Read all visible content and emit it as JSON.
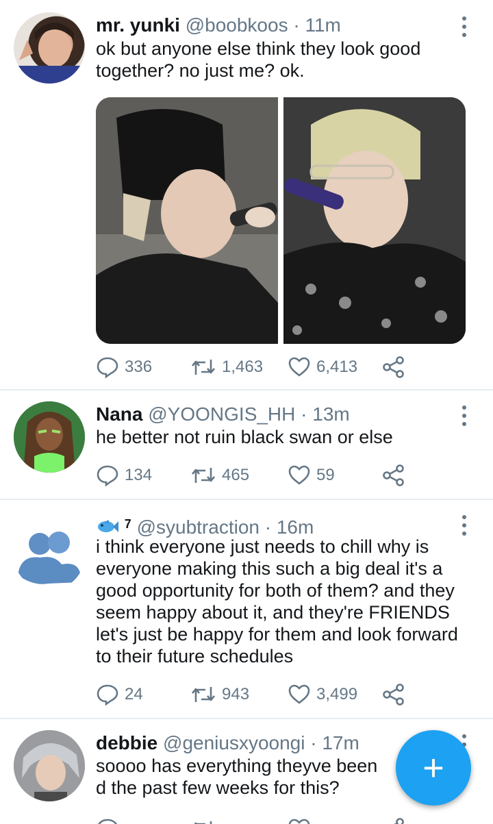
{
  "tweets": [
    {
      "name": "mr. yunki",
      "handle": "@boobkoos",
      "time": "· 11m",
      "text": "ok but anyone else think they look good together? no just me? ok.",
      "replies": "336",
      "retweets": "1,463",
      "likes": "6,413"
    },
    {
      "name": "Nana",
      "handle": "@YOONGIS_HH",
      "time": "· 13m",
      "text": "he better not ruin black swan or else",
      "replies": "134",
      "retweets": "465",
      "likes": "59"
    },
    {
      "name_superscript": "7",
      "handle": "@syubtraction",
      "time": "· 16m",
      "text": "i think everyone just needs to chill why is everyone making this such a big deal it's a good opportunity for both of them? and they seem happy about it, and they're FRIENDS let's just be happy for them and look forward to their future schedules",
      "replies": "24",
      "retweets": "943",
      "likes": "3,499"
    },
    {
      "name": "debbie",
      "handle": "@geniusxyoongi",
      "time": "· 17m",
      "text": "soooo has everything theyve been d the past few weeks for this?"
    }
  ],
  "fab": {
    "label": "+"
  },
  "colors": {
    "accent": "#1da1f2",
    "muted": "#657786",
    "divider": "#e6ecf0"
  },
  "icons": [
    "reply-icon",
    "retweet-icon",
    "like-icon",
    "share-icon",
    "more-icon",
    "fish-emoji-icon",
    "compose-icon"
  ]
}
